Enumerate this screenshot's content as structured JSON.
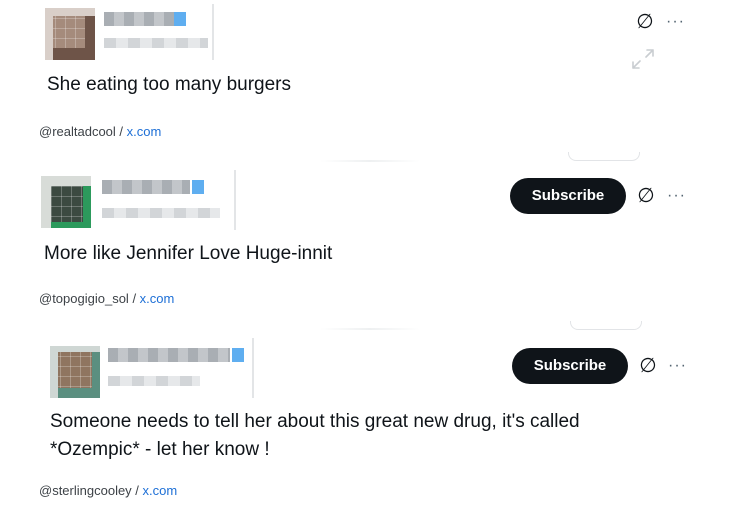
{
  "posts": [
    {
      "text": "She eating too many burgers",
      "handle": "@realtadcool",
      "separator": " / ",
      "site": "x.com",
      "has_subscribe": false
    },
    {
      "text": "More like Jennifer Love Huge-innit",
      "handle": "@topogigio_sol",
      "separator": " / ",
      "site": "x.com",
      "has_subscribe": true,
      "subscribe_label": "Subscribe"
    },
    {
      "text": "Someone needs to tell her about this great new drug, it's called\n*Ozempic* - let her know !",
      "handle": "@sterlingcooley",
      "separator": " / ",
      "site": "x.com",
      "has_subscribe": true,
      "subscribe_label": "Subscribe"
    }
  ],
  "icons": {
    "not_interested": "circle-slash-icon",
    "more": "more-options-icon",
    "expand": "expand-icon"
  },
  "glyphs": {
    "more": "···",
    "not_interested": "∅"
  },
  "colors": {
    "subscribe_bg": "#0f1419",
    "link": "#1d6fd6"
  }
}
